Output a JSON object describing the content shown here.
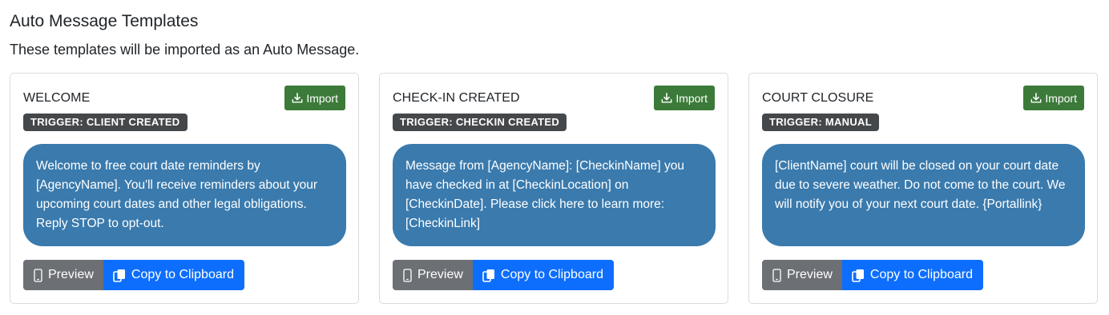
{
  "header": {
    "title": "Auto Message Templates",
    "subtitle": "These templates will be imported as an Auto Message."
  },
  "cards": [
    {
      "title": "WELCOME",
      "trigger": "TRIGGER: CLIENT CREATED",
      "message": "Welcome to free court date reminders by [AgencyName]. You'll receive reminders about your upcoming court dates and other legal obligations. Reply STOP to opt-out.",
      "import_label": "Import",
      "preview_label": "Preview",
      "copy_label": "Copy to Clipboard"
    },
    {
      "title": "CHECK-IN CREATED",
      "trigger": "TRIGGER: CHECKIN CREATED",
      "message": "Message from [AgencyName]: [CheckinName] you have checked in at [CheckinLocation] on [CheckinDate]. Please click here to learn more: [CheckinLink]",
      "import_label": "Import",
      "preview_label": "Preview",
      "copy_label": "Copy to Clipboard"
    },
    {
      "title": "COURT CLOSURE",
      "trigger": "TRIGGER: MANUAL",
      "message": "[ClientName] court will be closed on your court date due to severe weather. Do not come to the court. We will notify you of your next court date. {Portallink}",
      "import_label": "Import",
      "preview_label": "Preview",
      "copy_label": "Copy to Clipboard"
    }
  ],
  "colors": {
    "import_button": "#3c7a3a",
    "trigger_badge": "#45484b",
    "message_bubble": "#3a7aad",
    "preview_button": "#6c7075",
    "copy_button": "#0d6efd"
  },
  "icons": {
    "import": "download-icon",
    "preview": "phone-icon",
    "copy": "clipboard-copy-icon"
  }
}
